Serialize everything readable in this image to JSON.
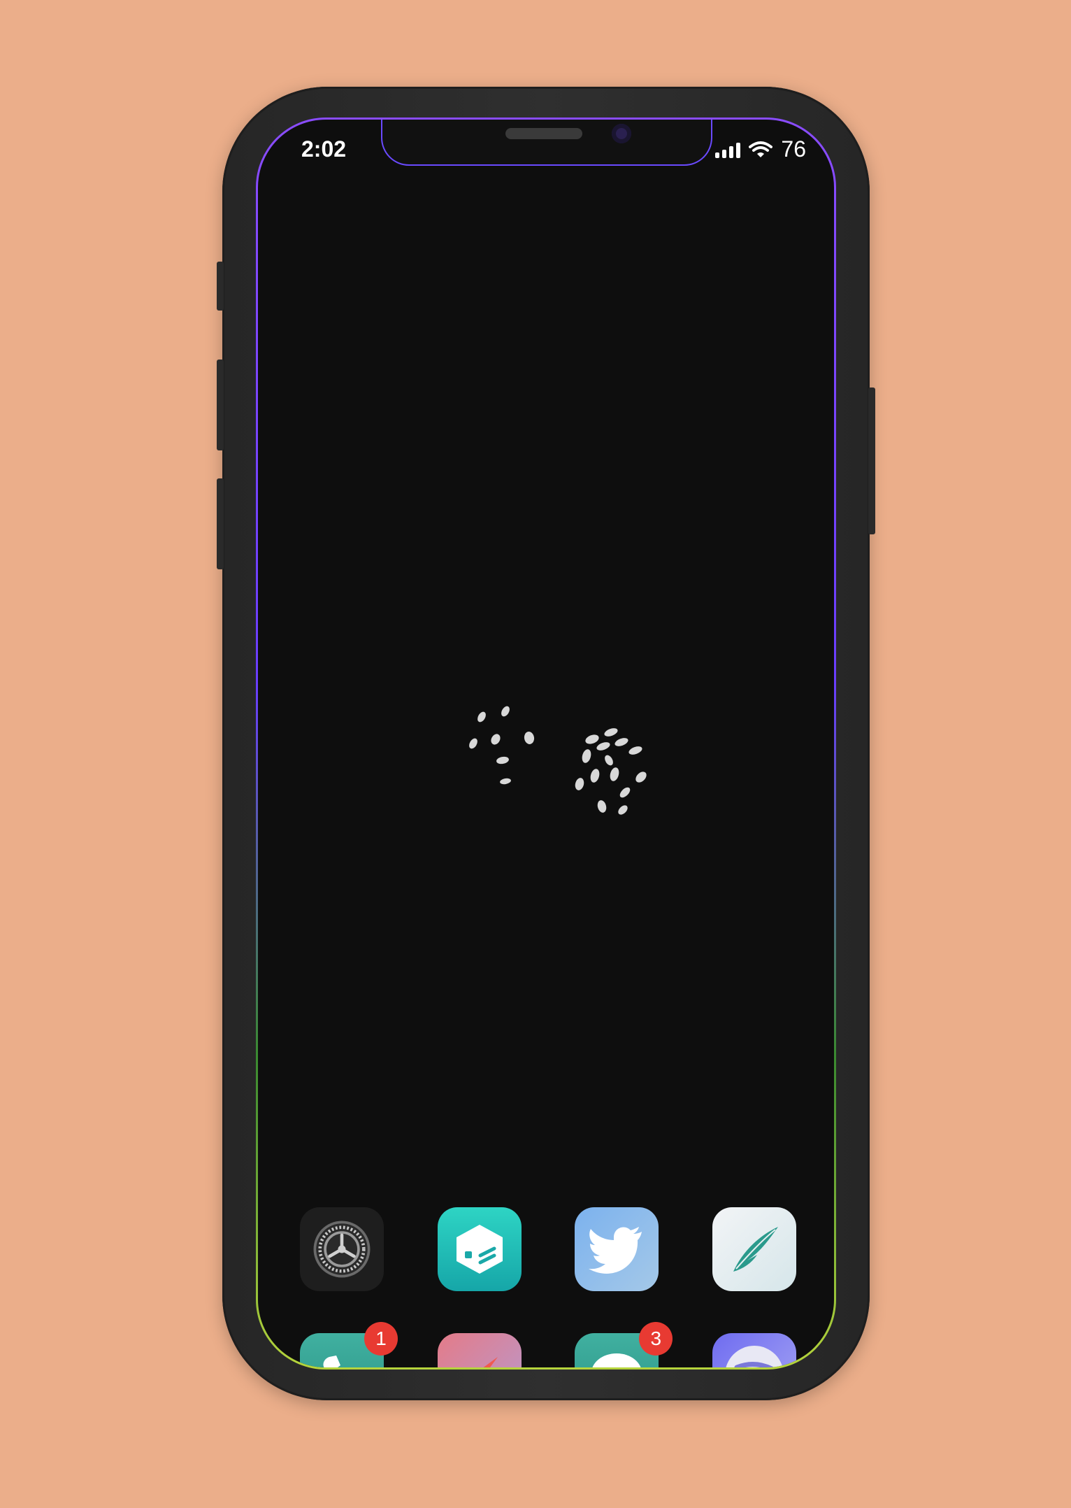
{
  "status_bar": {
    "time": "2:02",
    "battery": "76"
  },
  "widget": {
    "icon": "dice-icon"
  },
  "home_screen": {
    "row1": [
      {
        "name": "settings",
        "icon": "gear-icon",
        "color": "#1e1e1e"
      },
      {
        "name": "sileo",
        "icon": "package-box-icon",
        "color": "#24c2b8"
      },
      {
        "name": "twitter",
        "icon": "bird-icon",
        "color": "#8ab4ea"
      },
      {
        "name": "cydia-like",
        "icon": "feather-icon",
        "color": "#dde8ec"
      }
    ],
    "row2": [
      {
        "name": "phone",
        "icon": "phone-icon",
        "color": "#3aa594",
        "badge": "1"
      },
      {
        "name": "safari",
        "icon": "compass-icon",
        "color": "#d88aa8"
      },
      {
        "name": "messages",
        "icon": "speech-bubble-icon",
        "color": "#3aa594",
        "badge": "3"
      },
      {
        "name": "spotify",
        "icon": "spotify-icon",
        "color": "#8c88f0"
      }
    ]
  },
  "colors": {
    "background": "#ebae8a",
    "screen": "#0e0e0e",
    "border_top": "#8a4cff",
    "border_bottom": "#b6d43c",
    "badge": "#e83a32"
  }
}
